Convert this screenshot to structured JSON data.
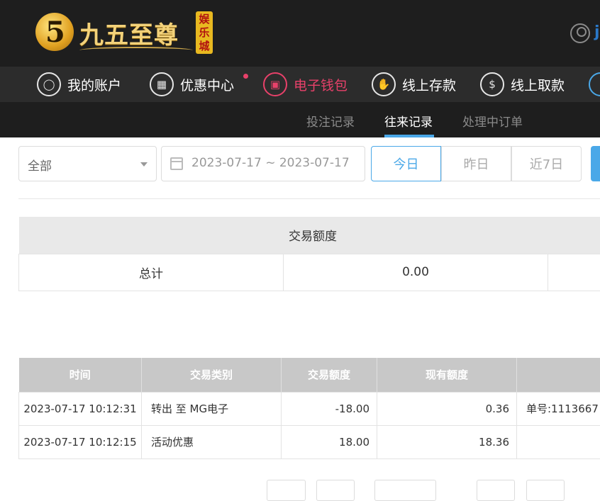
{
  "brand": {
    "logo_digit": "5",
    "name": "九五至尊",
    "stamp": "娱乐城"
  },
  "header": {
    "user_text": "j"
  },
  "nav": {
    "items": [
      {
        "label": "我的账户",
        "icon": "user-icon"
      },
      {
        "label": "优惠中心",
        "icon": "gift-icon"
      },
      {
        "label": "电子钱包",
        "icon": "wallet-icon"
      },
      {
        "label": "线上存款",
        "icon": "deposit-icon"
      },
      {
        "label": "线上取款",
        "icon": "withdraw-icon"
      }
    ],
    "active_color": "#e8416a"
  },
  "subnav": {
    "tabs": [
      "投注记录",
      "往来记录",
      "处理中订单"
    ],
    "active": "往来记录",
    "accent": "#4aa8e8"
  },
  "filters": {
    "type_select": "全部",
    "date_range": "2023-07-17 ~ 2023-07-17",
    "quick": [
      "今日",
      "昨日",
      "近7日"
    ],
    "quick_active": "今日"
  },
  "summary": {
    "header": "交易额度",
    "row_label": "总计",
    "total": "0.00"
  },
  "records": {
    "columns": [
      "时间",
      "交易类别",
      "交易额度",
      "现有额度",
      ""
    ],
    "rows": [
      [
        "2023-07-17 10:12:31",
        "转出 至 MG电子",
        "-18.00",
        "0.36",
        "单号:1113667"
      ],
      [
        "2023-07-17 10:12:15",
        "活动优惠",
        "18.00",
        "18.36",
        ""
      ]
    ]
  }
}
